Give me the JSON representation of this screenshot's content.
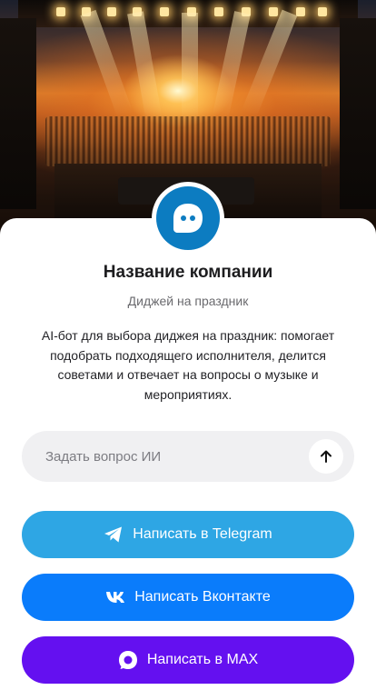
{
  "hero": {
    "alt_icon": "concert-stage-image"
  },
  "company": {
    "name": "Название компании",
    "subtitle": "Диджей на праздник",
    "description": "AI-бот для выбора диджея на праздник: помогает подобрать подходящего исполнителя, делится советами и отвечает на вопросы о музыке и мероприятиях."
  },
  "ask": {
    "placeholder": "Задать вопрос ИИ",
    "value": ""
  },
  "buttons": {
    "telegram": {
      "label": "Написать в Telegram",
      "icon": "telegram-icon",
      "color": "#2ea6e4"
    },
    "vk": {
      "label": "Написать Вконтакте",
      "icon": "vk-icon",
      "color": "#0a7cfb"
    },
    "max": {
      "label": "Написать в MAX",
      "icon": "max-icon",
      "color": "#6410f0"
    }
  },
  "colors": {
    "avatar": "#0c7cc1",
    "card": "#ffffff",
    "input_bg": "#f0f0f2"
  }
}
